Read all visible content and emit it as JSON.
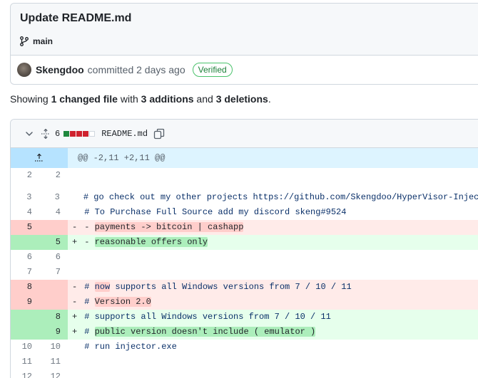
{
  "commit": {
    "title": "Update README.md",
    "branch": "main",
    "author": "Skengdoo",
    "committed_text": "committed 2 days ago",
    "verified_label": "Verified"
  },
  "summary": {
    "showing": "Showing ",
    "changed": "1 changed file",
    "with": " with ",
    "additions": "3 additions",
    "and": " and ",
    "deletions": "3 deletions",
    "period": "."
  },
  "file": {
    "diffstat_count": "6",
    "diffstat_blocks": [
      "add",
      "del",
      "del",
      "del",
      "neu"
    ],
    "name": "README.md",
    "hunk_header": "@@ -2,11 +2,11 @@"
  },
  "diff_lines": [
    {
      "type": "ctx",
      "old": "2",
      "new": "2",
      "marker": "",
      "parts": [
        {
          "t": ""
        }
      ]
    },
    {
      "type": "blank"
    },
    {
      "type": "ctx",
      "old": "3",
      "new": "3",
      "marker": "",
      "parts": [
        {
          "t": " # go check out my other projects https://github.com/Skengdoo/HyperVisor-Injector",
          "c": "comment"
        }
      ]
    },
    {
      "type": "ctx",
      "old": "4",
      "new": "4",
      "marker": "",
      "parts": [
        {
          "t": " # To Purchase Full Source add my discord skeng#9524",
          "c": "comment"
        }
      ]
    },
    {
      "type": "del",
      "old": "5",
      "new": "",
      "marker": "-",
      "parts": [
        {
          "t": " - "
        },
        {
          "t": "payments -> bitcoin | cashapp",
          "h": true
        }
      ]
    },
    {
      "type": "add",
      "old": "",
      "new": "5",
      "marker": "+",
      "parts": [
        {
          "t": " - "
        },
        {
          "t": "reasonable offers only",
          "h": true
        }
      ]
    },
    {
      "type": "ctx",
      "old": "6",
      "new": "6",
      "marker": "",
      "parts": [
        {
          "t": ""
        }
      ]
    },
    {
      "type": "ctx",
      "old": "7",
      "new": "7",
      "marker": "",
      "parts": [
        {
          "t": ""
        }
      ]
    },
    {
      "type": "del",
      "old": "8",
      "new": "",
      "marker": "-",
      "parts": [
        {
          "t": " # ",
          "c": "comment"
        },
        {
          "t": "now",
          "h": true,
          "c": "comment"
        },
        {
          "t": " supports all Windows versions from 7 / 10 / 11",
          "c": "comment"
        }
      ]
    },
    {
      "type": "del",
      "old": "9",
      "new": "",
      "marker": "-",
      "parts": [
        {
          "t": " # ",
          "c": "comment"
        },
        {
          "t": "Version 2.0",
          "h": true
        }
      ]
    },
    {
      "type": "add",
      "old": "",
      "new": "8",
      "marker": "+",
      "parts": [
        {
          "t": " # supports all Windows versions from 7 / 10 / 11",
          "c": "comment"
        }
      ]
    },
    {
      "type": "add",
      "old": "",
      "new": "9",
      "marker": "+",
      "parts": [
        {
          "t": " # ",
          "c": "comment"
        },
        {
          "t": "public version doesn't include ( emulator )",
          "h": true
        }
      ]
    },
    {
      "type": "ctx",
      "old": "10",
      "new": "10",
      "marker": "",
      "parts": [
        {
          "t": " # run injector.exe",
          "c": "comment"
        }
      ]
    },
    {
      "type": "ctx",
      "old": "11",
      "new": "11",
      "marker": "",
      "parts": [
        {
          "t": ""
        }
      ]
    },
    {
      "type": "ctx",
      "old": "12",
      "new": "12",
      "marker": "",
      "parts": [
        {
          "t": ""
        }
      ]
    }
  ],
  "colors": {
    "verified": "#1a7f37",
    "addition_bg": "#e6ffec",
    "deletion_bg": "#ffebe9",
    "hunk_bg": "#ddf4ff"
  }
}
